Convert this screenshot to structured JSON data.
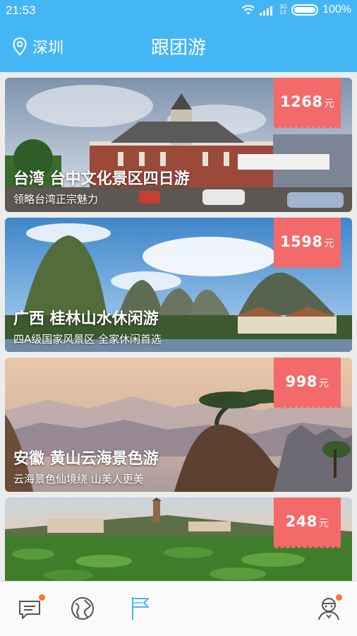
{
  "status_bar": {
    "time": "21:53",
    "network_top": "3G",
    "network_bottom": "1X",
    "battery": "100%"
  },
  "header": {
    "city": "深圳",
    "title": "跟团游"
  },
  "colors": {
    "header": "#44b6f4",
    "price_tag": "#f46a6a",
    "badge": "#f5782c",
    "nav_active": "#44b6f4",
    "nav_inactive": "#555555"
  },
  "tours": [
    {
      "price": "1268",
      "unit": "元",
      "title": "台湾  台中文化景区四日游",
      "subtitle": "领略台湾正宗魅力"
    },
    {
      "price": "1598",
      "unit": "元",
      "title": "广西  桂林山水休闲游",
      "subtitle": "四A级国家风景区 全家休闲首选"
    },
    {
      "price": "998",
      "unit": "元",
      "title": "安徽  黄山云海景色游",
      "subtitle": "云海景色仙境绕 山美人更美"
    },
    {
      "price": "248",
      "unit": "元",
      "title": "",
      "subtitle": ""
    }
  ],
  "bottom_nav": [
    {
      "icon": "chat-icon",
      "active": false,
      "badge": true
    },
    {
      "icon": "globe-icon",
      "active": false,
      "badge": false
    },
    {
      "icon": "flag-icon",
      "active": true,
      "badge": false
    },
    {
      "icon": "profile-icon",
      "active": false,
      "badge": true
    }
  ]
}
